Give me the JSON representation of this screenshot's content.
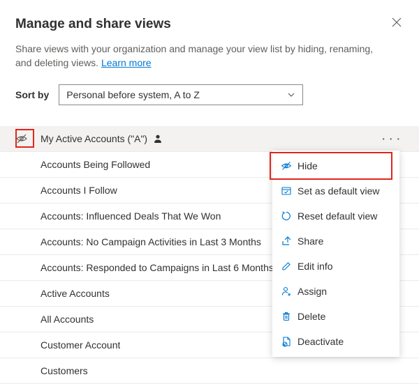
{
  "dialog": {
    "title": "Manage and share views",
    "subheading": "Share views with your organization and manage your view list by hiding, renaming, and deleting views. ",
    "learn_more": "Learn more"
  },
  "sort": {
    "label": "Sort by",
    "selected": "Personal before system, A to Z"
  },
  "views": [
    {
      "label": "My Active Accounts (\"A\")",
      "active": true,
      "personal": true
    },
    {
      "label": "Accounts Being Followed"
    },
    {
      "label": "Accounts I Follow"
    },
    {
      "label": "Accounts: Influenced Deals That We Won"
    },
    {
      "label": "Accounts: No Campaign Activities in Last 3 Months"
    },
    {
      "label": "Accounts: Responded to Campaigns in Last 6 Months"
    },
    {
      "label": "Active Accounts"
    },
    {
      "label": "All Accounts"
    },
    {
      "label": "Customer Account"
    },
    {
      "label": "Customers"
    }
  ],
  "menu": {
    "hide": "Hide",
    "set_default": "Set as default view",
    "reset_default": "Reset default view",
    "share": "Share",
    "edit_info": "Edit info",
    "assign": "Assign",
    "delete": "Delete",
    "deactivate": "Deactivate"
  }
}
